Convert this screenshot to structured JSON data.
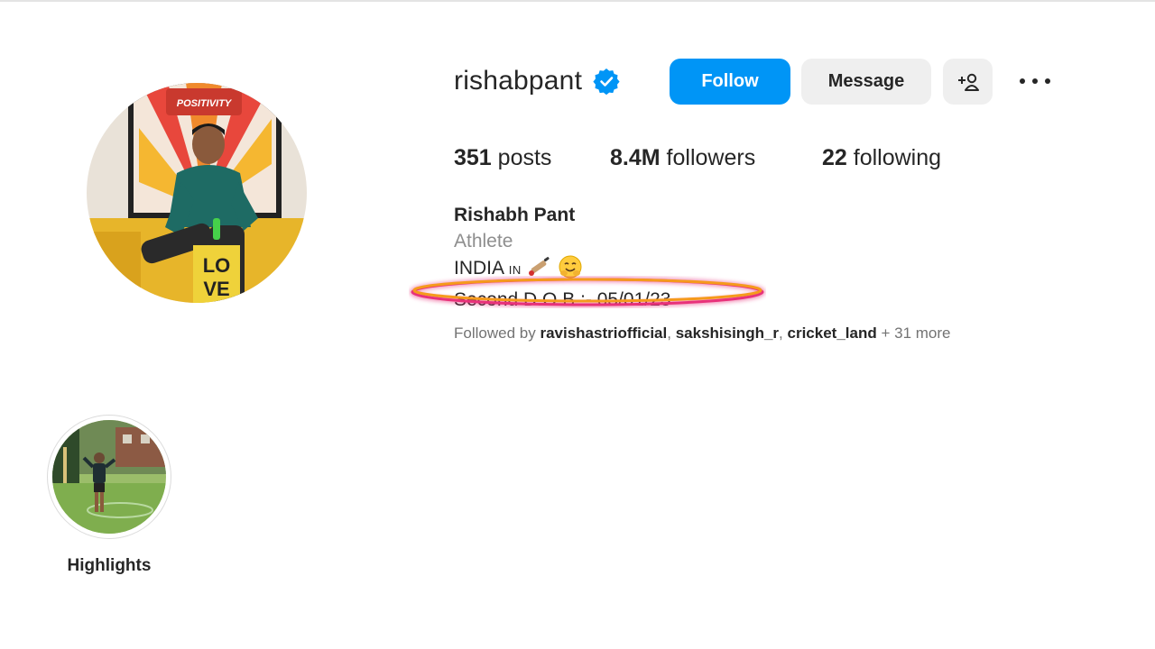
{
  "profile": {
    "username": "rishabpant",
    "verified": true,
    "avatar_icon": "profile-photo"
  },
  "actions": {
    "follow_label": "Follow",
    "message_label": "Message",
    "suggest_icon": "person-plus-icon",
    "more_icon": "more-horizontal-icon"
  },
  "stats": {
    "posts_count": "351",
    "posts_label": "posts",
    "followers_count": "8.4M",
    "followers_label": "followers",
    "following_count": "22",
    "following_label": "following"
  },
  "bio": {
    "full_name": "Rishabh Pant",
    "category": "Athlete",
    "line1_text": "INDIA",
    "line1_flag_text": "IN",
    "line2": "Second D.O.B :- 05/01/23"
  },
  "followed_by": {
    "prefix": "Followed by",
    "user1": "ravishastriofficial",
    "sep1": ",",
    "user2": "sakshisingh_r",
    "sep2": ",",
    "user3": "cricket_land",
    "more": "+ 31 more"
  },
  "highlights": [
    {
      "label": "Highlights"
    }
  ],
  "colors": {
    "follow_blue": "#0095f6",
    "secondary_button": "#efefef",
    "muted_text": "#8e8e8e",
    "annotation_orange": "#f59a1c",
    "annotation_pink": "#e8327a"
  }
}
